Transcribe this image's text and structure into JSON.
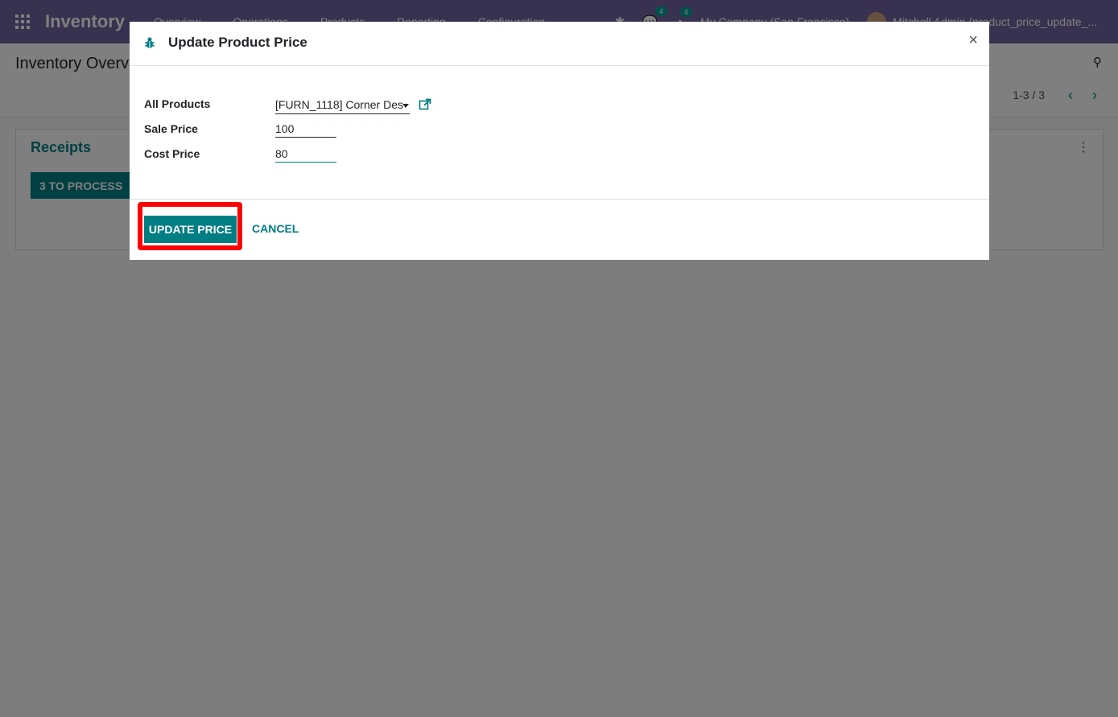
{
  "navbar": {
    "brand": "Inventory",
    "menu": [
      "Overview",
      "Operations",
      "Products",
      "Reporting",
      "Configuration"
    ],
    "badges": {
      "messages": "4",
      "activities": "4"
    },
    "company": "My Company (San Francisco)",
    "user": "Mitchell Admin (product_price_update_..."
  },
  "control_panel": {
    "title": "Inventory Overview",
    "pager": "1-3 / 3"
  },
  "card": {
    "title": "Receipts",
    "button": "3 TO PROCESS"
  },
  "modal": {
    "title": "Update Product Price",
    "fields": {
      "product_label": "All Products",
      "product_value": "[FURN_1118] Corner Des",
      "sale_label": "Sale Price",
      "sale_value": "100",
      "cost_label": "Cost Price",
      "cost_value": "80"
    },
    "buttons": {
      "update": "UPDATE PRICE",
      "cancel": "CANCEL",
      "close": "×"
    }
  },
  "colors": {
    "navbar": "#71639e",
    "primary": "#017e84",
    "highlight": "#ff0000"
  }
}
